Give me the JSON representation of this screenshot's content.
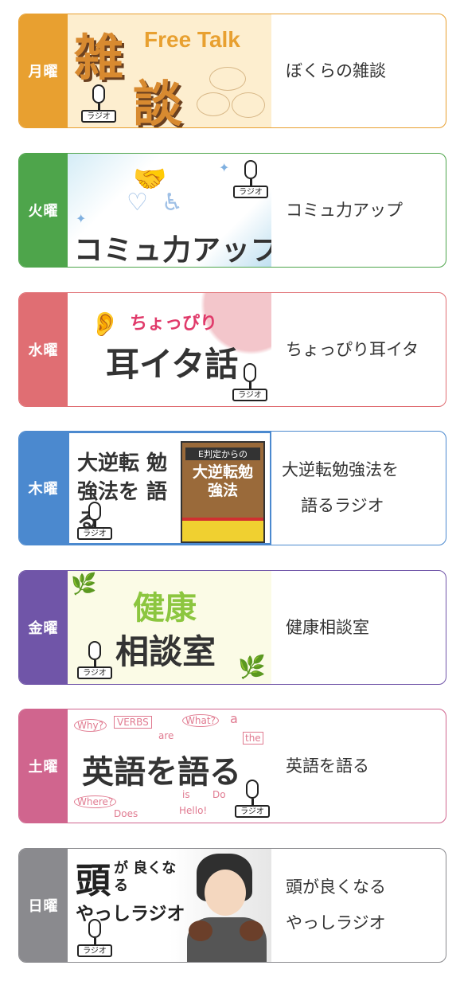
{
  "mic_label": "ラジオ",
  "programs": [
    {
      "day": "月曜",
      "color": "#e8a030",
      "thumb_title_1": "雑",
      "thumb_title_2": "談",
      "thumb_sub": "Free Talk",
      "desc_lines": [
        "ぼくらの雑談"
      ]
    },
    {
      "day": "火曜",
      "color": "#4ea54b",
      "thumb_title": "コミュ力アップ",
      "desc_lines": [
        "コミュ力アップ"
      ]
    },
    {
      "day": "水曜",
      "color": "#e06e73",
      "thumb_sub": "ちょっぴり",
      "thumb_title": "耳イタ話",
      "desc_lines": [
        "ちょっぴり耳イタ"
      ]
    },
    {
      "day": "木曜",
      "color": "#4b89cf",
      "thumb_title": "大逆転 勉強法を 語る",
      "book_small": "E判定からの",
      "book_title": "大逆転勉強法",
      "desc_lines": [
        "大逆転勉強法を",
        "語るラジオ"
      ]
    },
    {
      "day": "金曜",
      "color": "#7055a8",
      "thumb_title_1": "健康",
      "thumb_title_2": "相談室",
      "desc_lines": [
        "健康相談室"
      ]
    },
    {
      "day": "土曜",
      "color": "#d0658e",
      "thumb_title": "英語を語る",
      "doodles": [
        "Why?",
        "VERBS",
        "are",
        "What?",
        "a",
        "the",
        "Where?",
        "Does",
        "is",
        "Do",
        "Hello!"
      ],
      "desc_lines": [
        "英語を語る"
      ]
    },
    {
      "day": "日曜",
      "color": "#8a8a8e",
      "thumb_title_1": "頭",
      "thumb_title_2": "が 良くなる",
      "thumb_title_3": "やっしラジオ",
      "desc_lines": [
        "頭が良くなる",
        "やっしラジオ"
      ]
    }
  ]
}
